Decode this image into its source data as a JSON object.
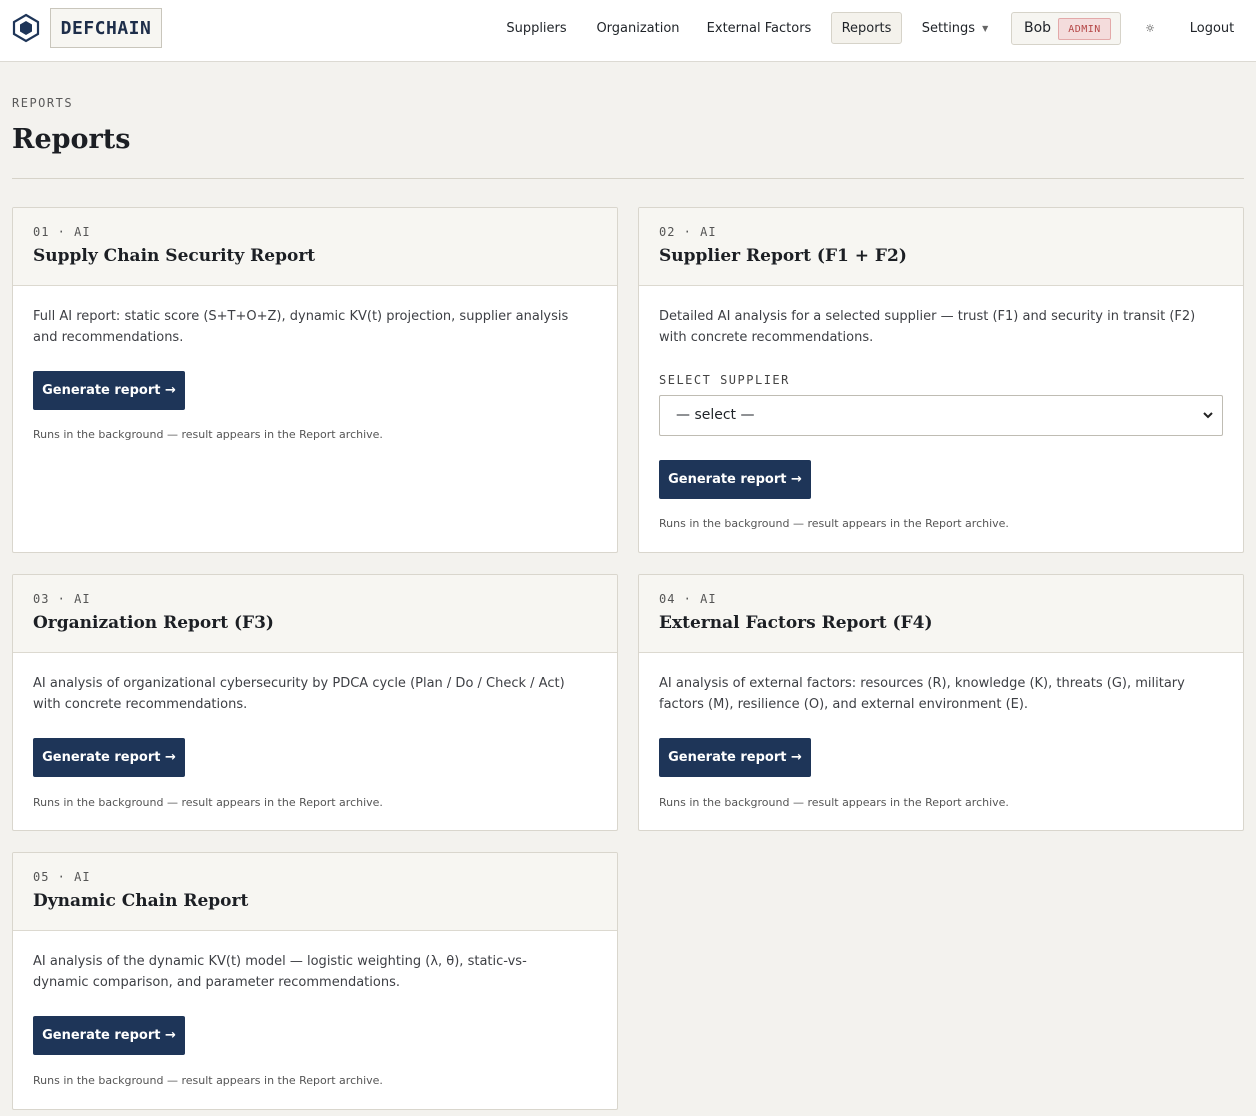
{
  "header": {
    "logo_text": "DEFCHAIN",
    "nav": [
      {
        "label": "Suppliers"
      },
      {
        "label": "Organization"
      },
      {
        "label": "External Factors"
      },
      {
        "label": "Reports"
      },
      {
        "label": "Settings"
      }
    ],
    "active_nav": "Reports",
    "user": {
      "name": "Bob",
      "role": "ADMIN"
    },
    "theme_icon": "☼",
    "logout": "Logout"
  },
  "page": {
    "breadcrumb": "REPORTS",
    "title": "Reports"
  },
  "cards": [
    {
      "number": "01 · AI",
      "title": "Supply Chain Security Report",
      "description": "Full AI report: static score (S+T+O+Z), dynamic KV(t) projection, supplier analysis and recommendations.",
      "button": "Generate report →",
      "note": "Runs in the background — result appears in the Report archive."
    },
    {
      "number": "02 · AI",
      "title": "Supplier Report (F1 + F2)",
      "description": "Detailed AI analysis for a selected supplier — trust (F1) and security in transit (F2) with concrete recommendations.",
      "select_label": "SELECT SUPPLIER",
      "select_value": "— select —",
      "button": "Generate report →",
      "note": "Runs in the background — result appears in the Report archive."
    },
    {
      "number": "03 · AI",
      "title": "Organization Report (F3)",
      "description": "AI analysis of organizational cybersecurity by PDCA cycle (Plan / Do / Check / Act) with concrete recommendations.",
      "button": "Generate report →",
      "note": "Runs in the background — result appears in the Report archive."
    },
    {
      "number": "04 · AI",
      "title": "External Factors Report (F4)",
      "description": "AI analysis of external factors: resources (R), knowledge (K), threats (G), military factors (M), resilience (O), and external environment (E).",
      "button": "Generate report →",
      "note": "Runs in the background — result appears in the Report archive."
    },
    {
      "number": "05 · AI",
      "title": "Dynamic Chain Report",
      "description": "AI analysis of the dynamic KV(t) model — logistic weighting (λ, θ), static-vs-dynamic comparison, and parameter recommendations.",
      "button": "Generate report →",
      "note": "Runs in the background — result appears in the Report archive."
    }
  ],
  "colors": {
    "accent": "#1e3558",
    "page_bg": "#f3f2ee",
    "badge_bg": "#f4dcdc",
    "badge_text": "#b54646"
  },
  "icons": {
    "logo": "hexagon-logo-icon",
    "theme": "sun-icon",
    "select": "chevron-down-icon",
    "settings": "caret-down-icon"
  }
}
